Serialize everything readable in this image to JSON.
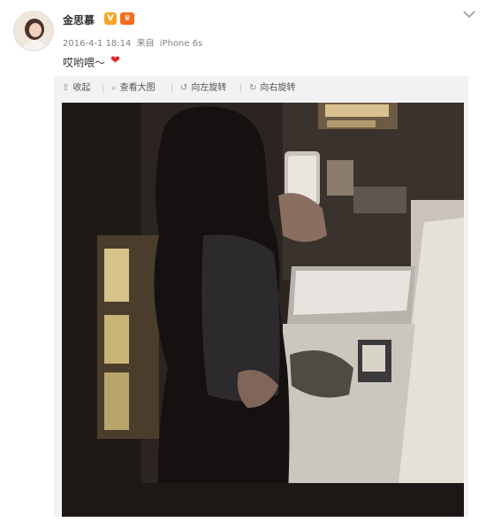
{
  "post": {
    "user_name": "金思慕",
    "verified_icon": "verified-v-icon",
    "member_icon": "member-crown-icon",
    "time": "2016-4-1 18:14",
    "source_prefix": "来自",
    "source_device": "iPhone 6s",
    "text": "哎哟喂～",
    "emoji": "red-heart-icon"
  },
  "media_toolbar": {
    "collapse_label": "收起",
    "view_large_label": "查看大图",
    "rotate_left_label": "向左旋转",
    "rotate_right_label": "向右旋转"
  },
  "colors": {
    "accent_orange": "#f6a623",
    "heart_red": "#e0262b",
    "text_dark": "#333333",
    "text_meta": "#808080"
  }
}
